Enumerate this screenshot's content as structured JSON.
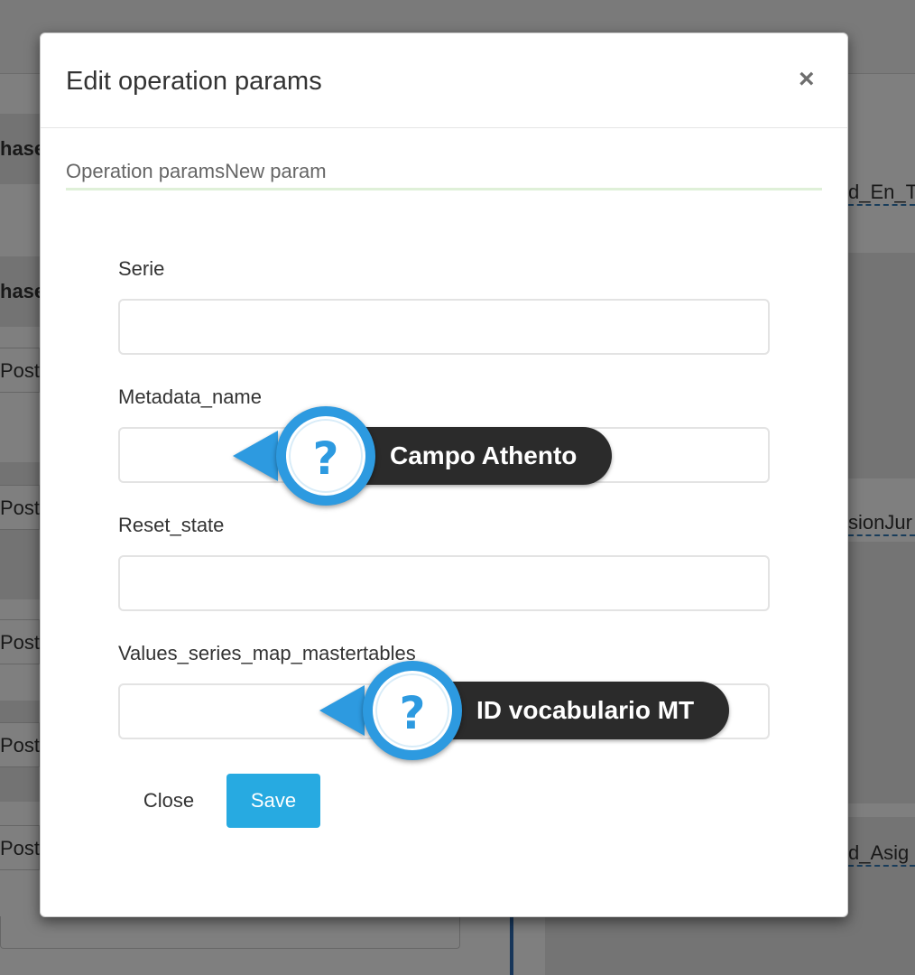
{
  "background": {
    "left_fragments": [
      "hase",
      "hase",
      "Post",
      "Post",
      "Post",
      "Post",
      "Post"
    ],
    "right_fragments": [
      "d_En_T",
      "sionJur",
      "d_Asig"
    ]
  },
  "modal": {
    "title": "Edit operation params",
    "close_glyph": "×",
    "tabs": [
      "Operation params",
      "New param"
    ],
    "fields": [
      {
        "label": "Serie",
        "value": ""
      },
      {
        "label": "Metadata_name",
        "value": ""
      },
      {
        "label": "Reset_state",
        "value": ""
      },
      {
        "label": "Values_series_map_mastertables",
        "value": ""
      }
    ],
    "close_label": "Close",
    "save_label": "Save"
  },
  "hints": [
    {
      "icon": "question-icon",
      "glyph": "?",
      "text": "Campo Athento"
    },
    {
      "icon": "question-icon",
      "glyph": "?",
      "text": "ID vocabulario MT"
    }
  ],
  "colors": {
    "accent": "#27aae1",
    "hint_blue": "#2d9ae0",
    "tab_underline": "#dff0d8"
  }
}
